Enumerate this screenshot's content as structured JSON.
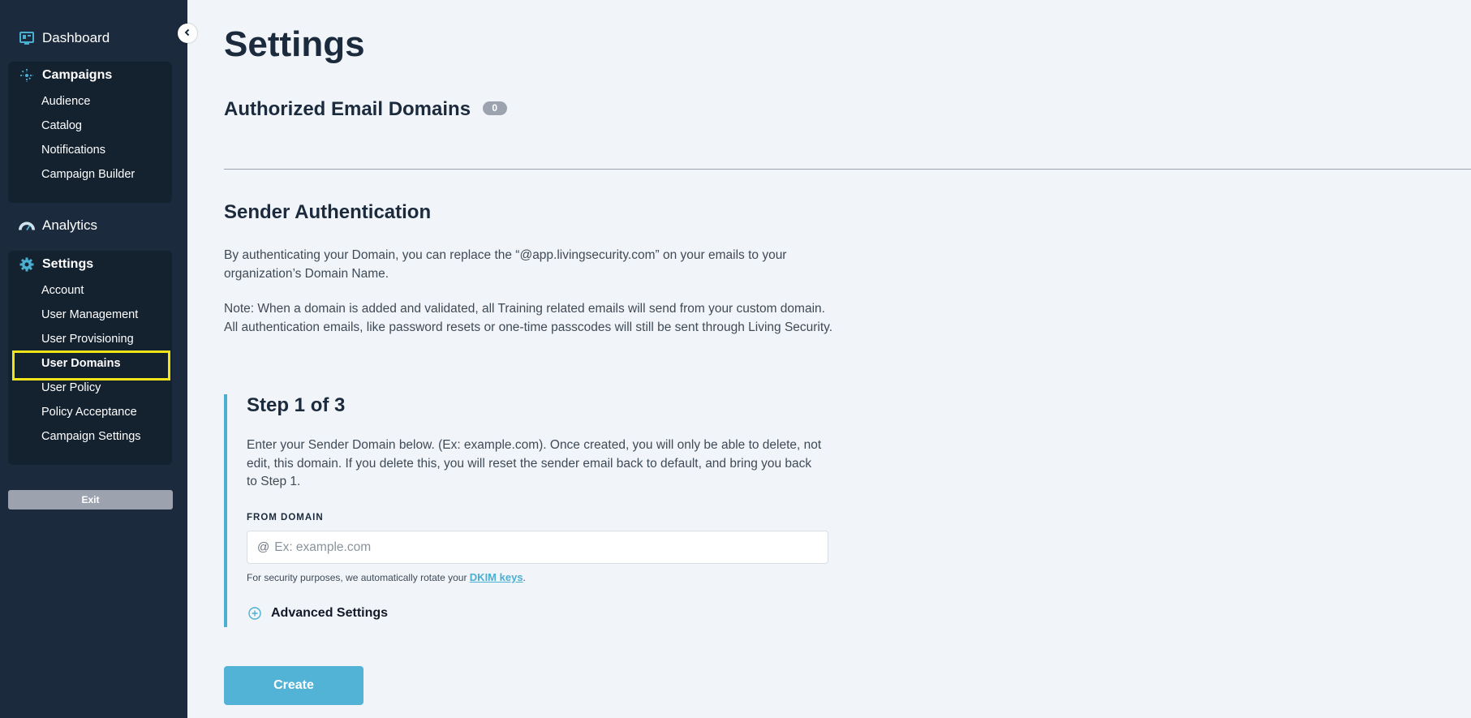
{
  "sidebar": {
    "dashboard": "Dashboard",
    "campaigns": {
      "title": "Campaigns",
      "items": [
        "Audience",
        "Catalog",
        "Notifications",
        "Campaign Builder"
      ]
    },
    "analytics": "Analytics",
    "settings": {
      "title": "Settings",
      "items": [
        "Account",
        "User Management",
        "User Provisioning",
        "User Domains",
        "User Policy",
        "Policy Acceptance",
        "Campaign Settings"
      ],
      "active": "User Domains"
    },
    "exit_label": "Exit"
  },
  "main": {
    "title": "Settings",
    "authorized": {
      "title": "Authorized Email Domains",
      "count": "0"
    },
    "sender": {
      "title": "Sender Authentication",
      "para1": "By authenticating your Domain, you can replace the “@app.livingsecurity.com” on your emails to your organization’s Domain Name.",
      "para2": "Note: When a domain is added and validated, all Training related emails will send from your custom domain. All authentication emails, like password resets or one-time passcodes will still be sent through Living Security."
    },
    "step": {
      "title": "Step 1 of 3",
      "description": "Enter your Sender Domain below. (Ex: example.com). Once created, you will only be able to delete, not edit, this domain. If you delete this, you will reset the sender email back to default, and bring you back to Step 1.",
      "field_label": "FROM DOMAIN",
      "at_symbol": "@",
      "placeholder": "Ex: example.com",
      "value": "",
      "hint_prefix": "For security purposes, we automatically rotate your",
      "hint_link": "DKIM keys",
      "hint_suffix": ".",
      "advanced_label": "Advanced Settings"
    },
    "create_label": "Create"
  },
  "colors": {
    "sidebar_bg": "#1b2a3c",
    "group_bg": "#14212f",
    "accent": "#4bafd1",
    "highlight": "#f0e518",
    "page_bg": "#f1f5f9"
  },
  "icons": {
    "dashboard": "dashboard-icon",
    "campaigns": "campaigns-icon",
    "analytics": "analytics-gauge-icon",
    "settings": "gear-icon",
    "collapse": "chevron-left-icon",
    "advanced": "plus-circle-icon"
  }
}
